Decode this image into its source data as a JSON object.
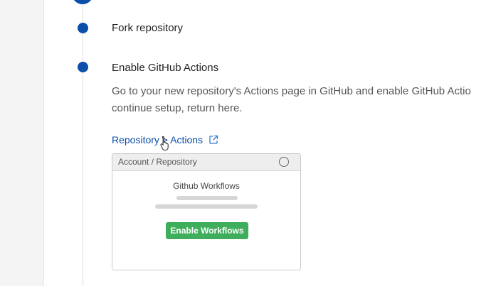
{
  "steps": [
    {
      "title": "Fork repository"
    },
    {
      "title": "Enable GitHub Actions"
    }
  ],
  "description": {
    "line1": "Go to your new repository's Actions page in GitHub and enable GitHub Actio",
    "line2": "continue setup, return here."
  },
  "link": {
    "label": "Repository > Actions",
    "icon": "external-link-icon"
  },
  "preview": {
    "header": "Account / Repository",
    "title": "Github Workflows",
    "button_label": "Enable Workflows"
  },
  "colors": {
    "accent": "#0b4fa8",
    "button": "#3fae5c"
  }
}
